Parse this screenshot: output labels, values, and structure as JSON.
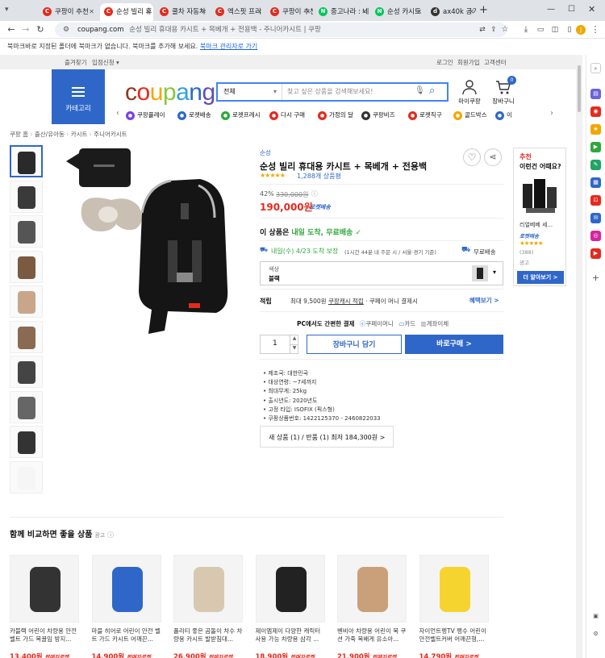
{
  "browser": {
    "tabs": [
      {
        "label": "쿠팡이 추천",
        "icon": "C",
        "color": "#e42a1d"
      },
      {
        "label": "순성 빌리 휴",
        "icon": "C",
        "color": "#e42a1d",
        "active": true
      },
      {
        "label": "쿨차 자동차",
        "icon": "C",
        "color": "#e42a1d"
      },
      {
        "label": "엑스핏 프리",
        "icon": "C",
        "color": "#e42a1d"
      },
      {
        "label": "쿠팡이 추천",
        "icon": "C",
        "color": "#e42a1d"
      },
      {
        "label": "중고나라 : 네",
        "icon": "N",
        "color": "#03c75a"
      },
      {
        "label": "순성 카시트",
        "icon": "N",
        "color": "#03c75a"
      },
      {
        "label": "ax40k 공기청",
        "icon": "d",
        "color": "#333333"
      }
    ],
    "new_tab": "+",
    "url_domain": "coupang.com",
    "url_rest": "순성 빌리 휴대용 카시트 + 목베개 + 전용백 - 주니어카시트 | 쿠팡",
    "bookmark_notice": "북마크바로 지정된 폴더에 북마크가 없습니다. 북마크를 추가해 보세요.",
    "bookmark_link": "북마크 관리자로 가기"
  },
  "site": {
    "topnav": {
      "left": [
        "즐겨찾기",
        "입점신청 ▾"
      ],
      "right": [
        "로그인",
        "회원가입",
        "고객센터"
      ]
    },
    "category_label": "카테고리",
    "logo": "coupang",
    "search_category": "전체",
    "search_placeholder": "찾고 싶은 상품을 검색해보세요!",
    "mypage": "마이쿠팡",
    "cart": "장바구니",
    "cart_count": "0",
    "shortcuts": [
      {
        "label": "쿠팡플레이",
        "color": "#7b3fe4"
      },
      {
        "label": "로켓배송",
        "color": "#2f67c9"
      },
      {
        "label": "로켓프레시",
        "color": "#2ea83c"
      },
      {
        "label": "다시 구매",
        "color": "#e42a1d"
      },
      {
        "label": "가정의 달",
        "color": "#e42a1d"
      },
      {
        "label": "쿠팡비즈",
        "color": "#333333"
      },
      {
        "label": "로켓직구",
        "color": "#e42a1d"
      },
      {
        "label": "골드박스",
        "color": "#f0a800"
      },
      {
        "label": "이",
        "color": "#2f67c9"
      }
    ],
    "breadcrumb": [
      "쿠팡 홈",
      "출산/유아동",
      "카시트",
      "주니어카시트"
    ]
  },
  "product": {
    "brand": "순성",
    "title": "순성 빌리 휴대용 카시트 + 목베개 + 전용백",
    "rating": 5,
    "reviews": "1,288개 상품평",
    "discount": "42%",
    "original_price": "330,000원",
    "price": "190,000원",
    "rocket": "로켓배송",
    "free_ship_prefix": "이 상품은",
    "free_ship_highlight": "내일 도착, 무료배송",
    "delivery_date": "내일(수) 4/23 도착 보장",
    "delivery_note": "(1시간 44분  내 주문 시 / 서울·경기 기준)",
    "free_delivery": "무료배송",
    "option_label": "색상",
    "option_value": "블랙",
    "points_label": "적립",
    "points_text_a": "최대 9,500원",
    "points_text_b": "쿠팡캐시 적립",
    "points_text_c": "· 쿠페이 머니 결제시",
    "benefit_link": "혜택보기 >",
    "pay_label_a": "PC에서도 간편한 결제",
    "pay_methods": [
      "쿠페이머니",
      "카드",
      "계좌이체"
    ],
    "qty": "1",
    "cart_button": "장바구니 담기",
    "buy_button": "바로구매 >",
    "specs": [
      "제조국: 대한민국",
      "대상연령: ~7세까지",
      "최대무게: 25kg",
      "출시년도: 2020년도",
      "고정 타입: ISOFIX (픽스형)",
      "쿠팡상품번호: 1422125370 - 2460822033"
    ],
    "sellers": "새 상품 (1) / 반품 (1) 최저 184,300원 >"
  },
  "ad": {
    "heading1": "추천",
    "heading2": "이런건 어때요?",
    "item_name": "리얼베베 세...",
    "rocket": "로켓배송",
    "reviews": "(388)",
    "ad_label": "광고",
    "more": "더 알아보기 >"
  },
  "compare": {
    "title": "함께 비교하면 좋을 상품",
    "ad_label": "광고",
    "items": [
      {
        "name": "카블랙 어린이 차량용 안전벨트 가드 목꿀임 방지...",
        "price": "13,400원",
        "tag": "판매자로켓"
      },
      {
        "name": "마블 히어로 어린이 안전 벨트 가드 카시트 어깨끈...",
        "price": "14,900원",
        "tag": "판매자로켓"
      },
      {
        "name": "폴리티 좋은 곰돌이 차수 차량용 카시트 발받침대...",
        "price": "26,900원",
        "tag": "판매자로켓"
      },
      {
        "name": "제이엠제이 다양한 캐릭터 사용 가능 차량용 삼각 ...",
        "price": "18,900원",
        "tag": "판매자로켓"
      },
      {
        "name": "벤비아 차량용 어린이 목 쿠션 가죽 목배게 유소아...",
        "price": "21,900원",
        "tag": "판매자로켓"
      },
      {
        "name": "자이언트펭TV 펭수 어린이 안전벨트커버 어깨끈형,...",
        "price": "14,790원",
        "tag": "판매자로켓"
      }
    ]
  }
}
